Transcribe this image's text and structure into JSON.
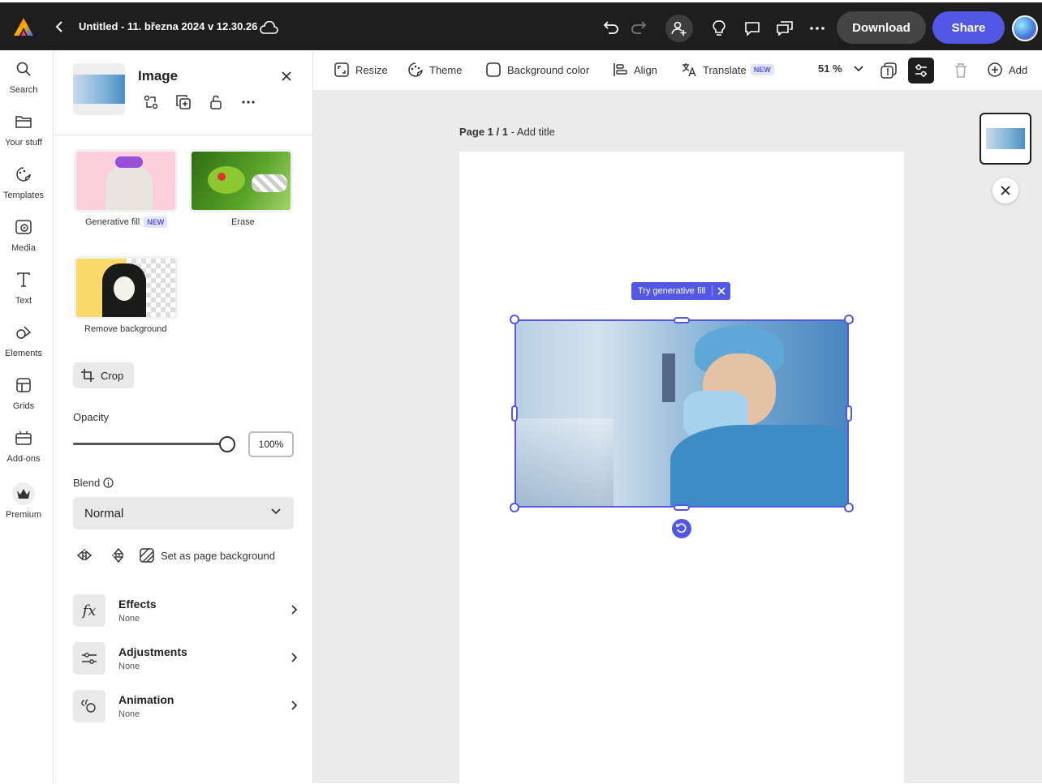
{
  "topbar": {
    "title": "Untitled - 11. března 2024 v 12.30.26",
    "download_label": "Download",
    "share_label": "Share",
    "icons": [
      "adobe-logo-icon",
      "back-chevron-icon",
      "cloud-icon",
      "undo-icon",
      "redo-icon",
      "invite-user-icon",
      "lightbulb-icon",
      "comment-icon",
      "chat-icon",
      "more-icon",
      "avatar"
    ]
  },
  "rail": {
    "items": [
      {
        "label": "Search",
        "icon": "search-icon"
      },
      {
        "label": "Your stuff",
        "icon": "folder-icon"
      },
      {
        "label": "Templates",
        "icon": "templates-icon"
      },
      {
        "label": "Media",
        "icon": "media-icon"
      },
      {
        "label": "Text",
        "icon": "text-icon"
      },
      {
        "label": "Elements",
        "icon": "elements-icon"
      },
      {
        "label": "Grids",
        "icon": "grids-icon"
      },
      {
        "label": "Add-ons",
        "icon": "addons-icon"
      },
      {
        "label": "Premium",
        "icon": "premium-icon"
      }
    ]
  },
  "panel": {
    "title": "Image",
    "tools": [
      {
        "label": "Generative fill",
        "badge": "NEW"
      },
      {
        "label": "Erase"
      },
      {
        "label": "Remove background"
      }
    ],
    "crop_label": "Crop",
    "opacity_label": "Opacity",
    "opacity_value": "100%",
    "opacity_fraction": 1.0,
    "blend_label": "Blend",
    "blend_value": "Normal",
    "set_bg_label": "Set as page background",
    "rows": [
      {
        "title": "Effects",
        "sub": "None",
        "icon": "fx-icon"
      },
      {
        "title": "Adjustments",
        "sub": "None",
        "icon": "sliders-icon"
      },
      {
        "title": "Animation",
        "sub": "None",
        "icon": "animation-icon"
      }
    ]
  },
  "toolbar": {
    "resize": "Resize",
    "theme": "Theme",
    "background_color": "Background color",
    "align": "Align",
    "translate": "Translate",
    "translate_badge": "NEW",
    "zoom": "51 %",
    "add": "Add"
  },
  "canvas": {
    "page_label": "Page 1 / 1",
    "add_title": "Add title",
    "try_fill_label": "Try generative fill"
  },
  "colors": {
    "accent": "#5258e4",
    "topbar": "#1e1e1e",
    "canvas_bg": "#ebebeb"
  }
}
